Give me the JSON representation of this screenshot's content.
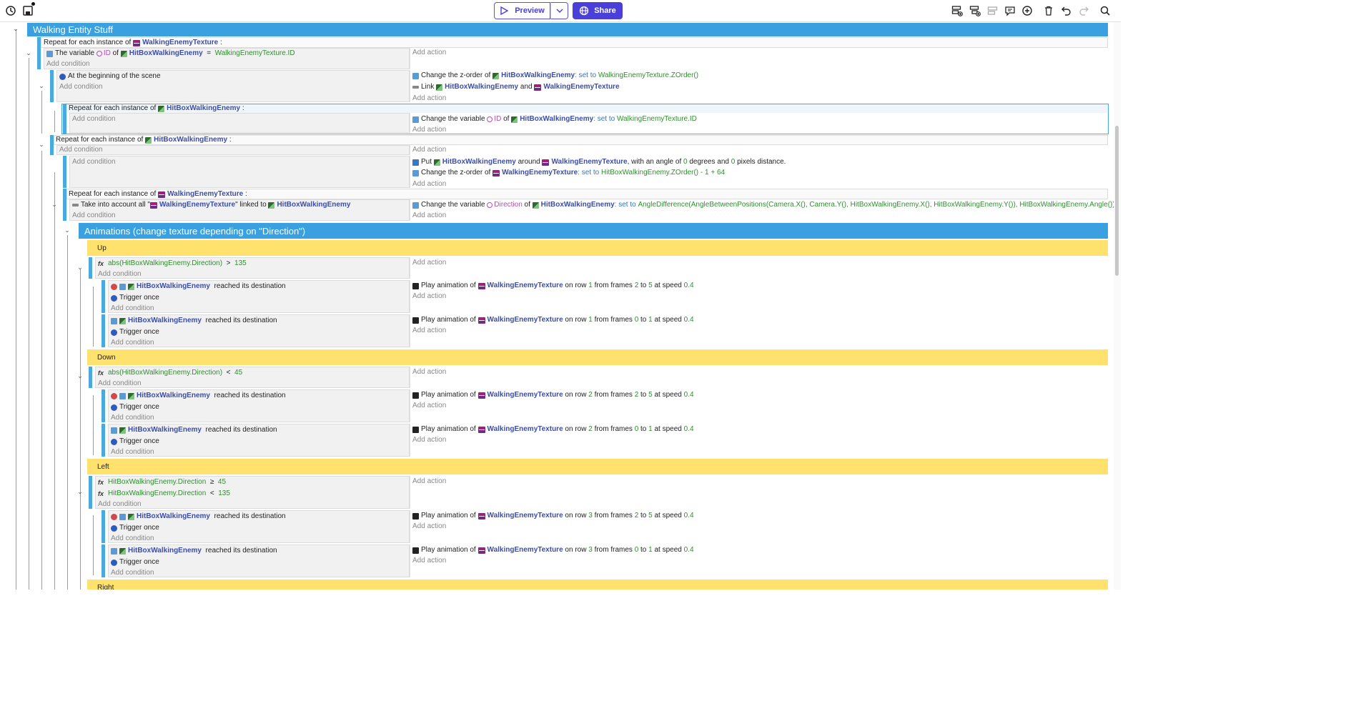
{
  "toolbar": {
    "preview_label": "Preview",
    "share_label": "Share",
    "left_icons": [
      "history-icon",
      "save-icon"
    ],
    "right_icons": [
      "add-event-icon",
      "add-subevent-icon",
      "toggle-disabled-icon",
      "add-comment-icon",
      "add-more-icon",
      "delete-icon",
      "undo-icon",
      "redo-icon",
      "search-icon"
    ],
    "accent_color": "#4a3fd9"
  },
  "events": {
    "group_walking": "Walking Entity Stuff",
    "repeat_texture": {
      "prefix": "Repeat for each instance of",
      "object": "WalkingEnemyTexture",
      "suffix": ":"
    },
    "cond_variable": {
      "prefix": "The variable",
      "var": "ID",
      "of": "of",
      "object": "HitBoxWalkingEnemy",
      "op": "=",
      "value": "WalkingEnemyTexture.ID"
    },
    "add_condition": "Add condition",
    "add_action": "Add action",
    "scene_begin": "At the beginning of the scene",
    "act_zorder1": {
      "prefix": "Change the z-order of",
      "object": "HitBoxWalkingEnemy",
      "setto": ": set to",
      "value": "WalkingEnemyTexture.ZOrder()"
    },
    "act_link": {
      "prefix": "Link",
      "object1": "HitBoxWalkingEnemy",
      "and": "and",
      "object2": "WalkingEnemyTexture"
    },
    "repeat_hitbox1": {
      "prefix": "Repeat for each instance of",
      "object": "HitBoxWalkingEnemy",
      "suffix": ":"
    },
    "act_change_id": {
      "prefix": "Change the variable",
      "var": "ID",
      "of": "of",
      "object": "HitBoxWalkingEnemy",
      "setto": ": set to",
      "value": "WalkingEnemyTexture.ID"
    },
    "repeat_hitbox2": {
      "prefix": "Repeat for each instance of",
      "object": "HitBoxWalkingEnemy",
      "suffix": ":"
    },
    "act_put": {
      "prefix": "Put",
      "object1": "HitBoxWalkingEnemy",
      "around": "around",
      "object2": "WalkingEnemyTexture",
      "angle_txt": ", with an angle of",
      "angle": "0",
      "deg_txt": "degrees and",
      "dist": "0",
      "dist_txt": "pixels distance."
    },
    "act_zorder2": {
      "prefix": "Change the z-order of",
      "object": "WalkingEnemyTexture",
      "setto": ": set to",
      "value": "HitBoxWalkingEnemy.ZOrder() - 1 + 64"
    },
    "repeat_texture2": {
      "prefix": "Repeat for each instance of",
      "object": "WalkingEnemyTexture",
      "suffix": ":"
    },
    "cond_take": {
      "prefix": "Take into account all \"",
      "object1": "WalkingEnemyTexture",
      "mid": "\" linked to",
      "object2": "HitBoxWalkingEnemy"
    },
    "act_direction": {
      "prefix": "Change the variable",
      "var": "Direction",
      "of": "of",
      "object": "HitBoxWalkingEnemy",
      "setto": ": set to",
      "value": "AngleDifference(AngleBetweenPositions(Camera.X(), Camera.Y(), HitBoxWalkingEnemy.X(), HitBoxWalkingEnemy.Y()), HitBoxWalkingEnemy.Angle())"
    },
    "group_anim": "Animations (change texture depending on \"Direction\")",
    "reached": "reached its destination",
    "trigger_once": "Trigger once",
    "hitbox": "HitBoxWalkingEnemy",
    "play": {
      "prefix": "Play animation of",
      "object": "WalkingEnemyTexture",
      "row_txt": "on row",
      "frames_txt": "from frames",
      "to_txt": "to",
      "speed_txt": "at speed",
      "speed": "0.4"
    },
    "up": {
      "label": "Up",
      "cond": "abs(HitBoxWalkingEnemy.Direction)",
      "op": ">",
      "value": "135",
      "row": "1"
    },
    "down": {
      "label": "Down",
      "cond": "abs(HitBoxWalkingEnemy.Direction)",
      "op": "<",
      "value": "45",
      "row": "2"
    },
    "left": {
      "label": "Left",
      "cond1": "HitBoxWalkingEnemy.Direction",
      "op1": "≥",
      "value1": "45",
      "cond2": "HitBoxWalkingEnemy.Direction",
      "op2": "<",
      "value2": "135",
      "row": "3"
    },
    "right": {
      "label": "Right"
    },
    "frames_a": {
      "from": "2",
      "to": "5"
    },
    "frames_b": {
      "from": "0",
      "to": "1"
    }
  }
}
